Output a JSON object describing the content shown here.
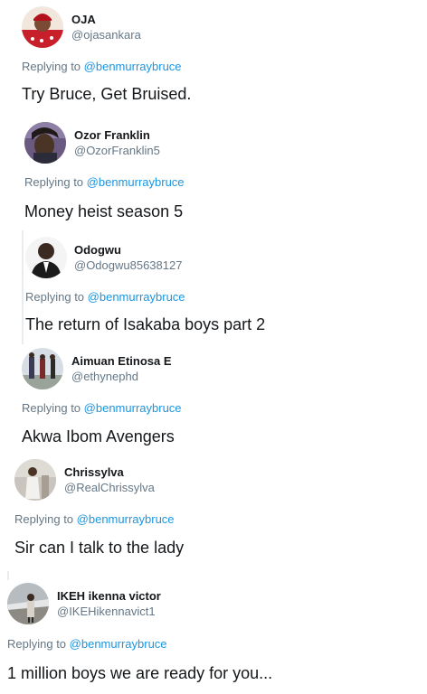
{
  "replies": [
    {
      "name": "OJA",
      "handle": "@ojasankara",
      "replying_prefix": "Replying to",
      "mention": "@benmurraybruce",
      "text": "Try Bruce, Get Bruised."
    },
    {
      "name": "Ozor Franklin",
      "handle": "@OzorFranklin5",
      "replying_prefix": "Replying to",
      "mention": "@benmurraybruce",
      "text": "Money heist season 5"
    },
    {
      "name": "Odogwu",
      "handle": "@Odogwu85638127",
      "replying_prefix": "Replying to",
      "mention": "@benmurraybruce",
      "text": "The return of Isakaba boys part 2"
    },
    {
      "name": "Aimuan Etinosa E",
      "handle": "@ethynephd",
      "replying_prefix": "Replying to",
      "mention": "@benmurraybruce",
      "text": "Akwa Ibom Avengers"
    },
    {
      "name": "Chrissylva",
      "handle": "@RealChrissylva",
      "replying_prefix": "Replying to",
      "mention": "@benmurraybruce",
      "text": "Sir can I talk to the lady"
    },
    {
      "name": "IKEH ikenna victor",
      "handle": "@IKEHikennavict1",
      "replying_prefix": "Replying to",
      "mention": "@benmurraybruce",
      "text": "1 million boys we are ready for you..."
    }
  ],
  "colors": {
    "text": "#14171a",
    "secondary": "#657786",
    "link": "#1b95e0",
    "thread_line": "#e6ecf0"
  }
}
